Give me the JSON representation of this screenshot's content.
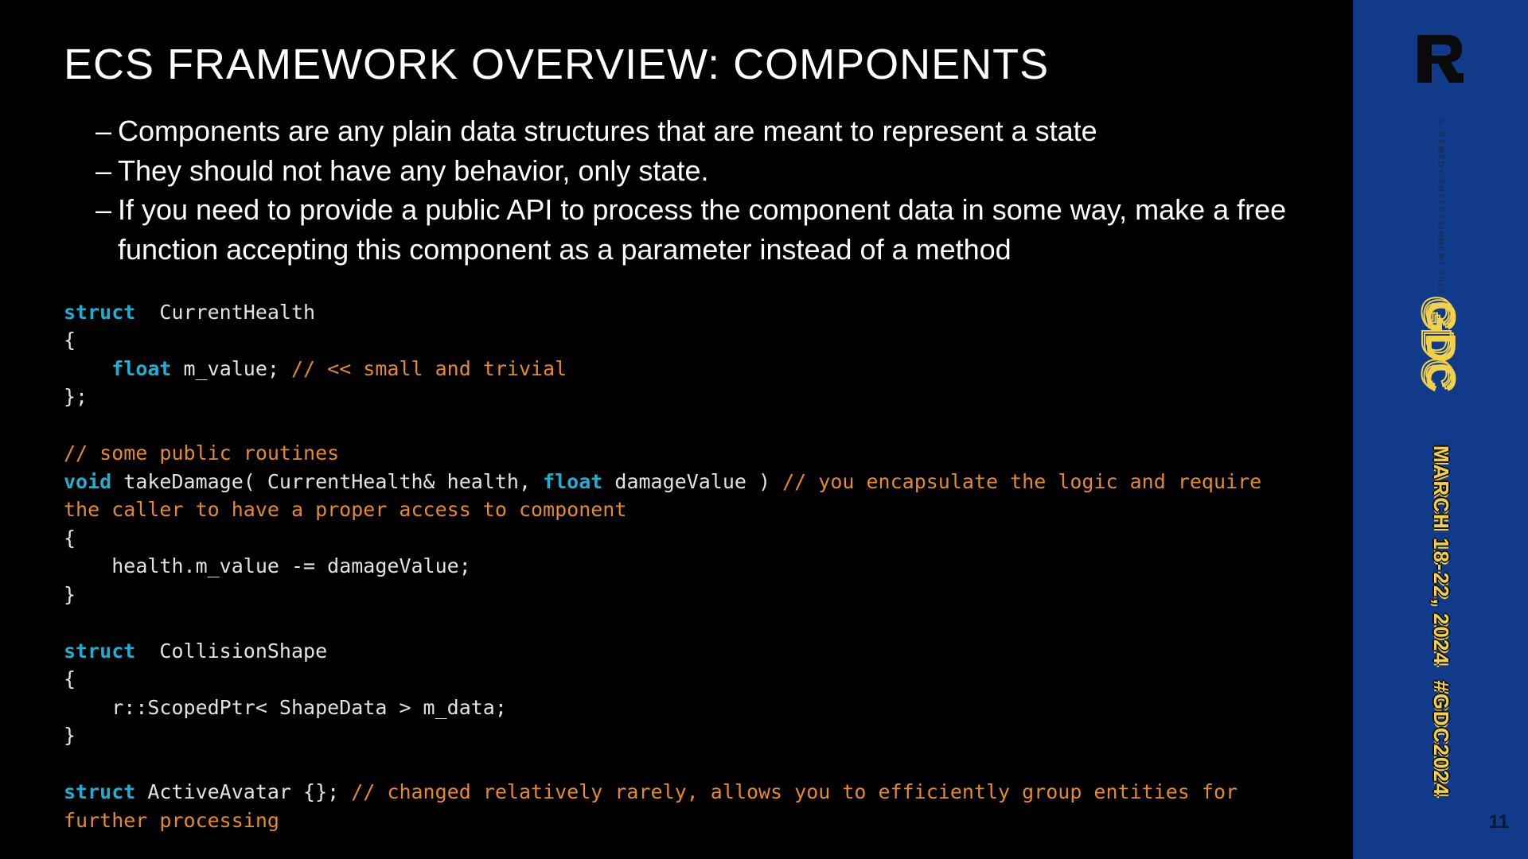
{
  "title": "ECS FRAMEWORK OVERVIEW: COMPONENTS",
  "bullets": [
    "Components are any plain data structures that are meant to represent a state",
    "They should not have any behavior, only state.",
    "If you need to provide a public API to process the component data in some way, make a free function accepting this component as a parameter instead of a method"
  ],
  "code": {
    "l1_kw": "struct",
    "l1_rest": "  CurrentHealth",
    "l2": "{",
    "l3_kw": "    float",
    "l3_rest": " m_value; ",
    "l3_cm": "// << small and trivial",
    "l4": "};",
    "l6_cm": "// some public routines",
    "l7_kw1": "void",
    "l7_mid": " takeDamage( CurrentHealth& health, ",
    "l7_kw2": "float",
    "l7_rest": " damageValue ) ",
    "l7_cm": "// you encapsulate the logic and require the caller to have a proper access to component",
    "l8": "{",
    "l9": "    health.m_value -= damageValue;",
    "l10": "}",
    "l12_kw": "struct",
    "l12_rest": "  CollisionShape",
    "l13": "{",
    "l14": "    r::ScopedPtr< ShapeData > m_data;",
    "l15": "}",
    "l17_kw": "struct",
    "l17_rest": " ActiveAvatar {}; ",
    "l17_cm": "// changed relatively rarely, allows you to efficiently group entities for further processing"
  },
  "sidebar": {
    "logo": "R",
    "copyright": "© REMEDY ENTERTAINMENT 2023",
    "gdc": "GDC",
    "date": "MARCH 18-22, 2024",
    "hashtag": "#GDC2024",
    "page": "11"
  }
}
